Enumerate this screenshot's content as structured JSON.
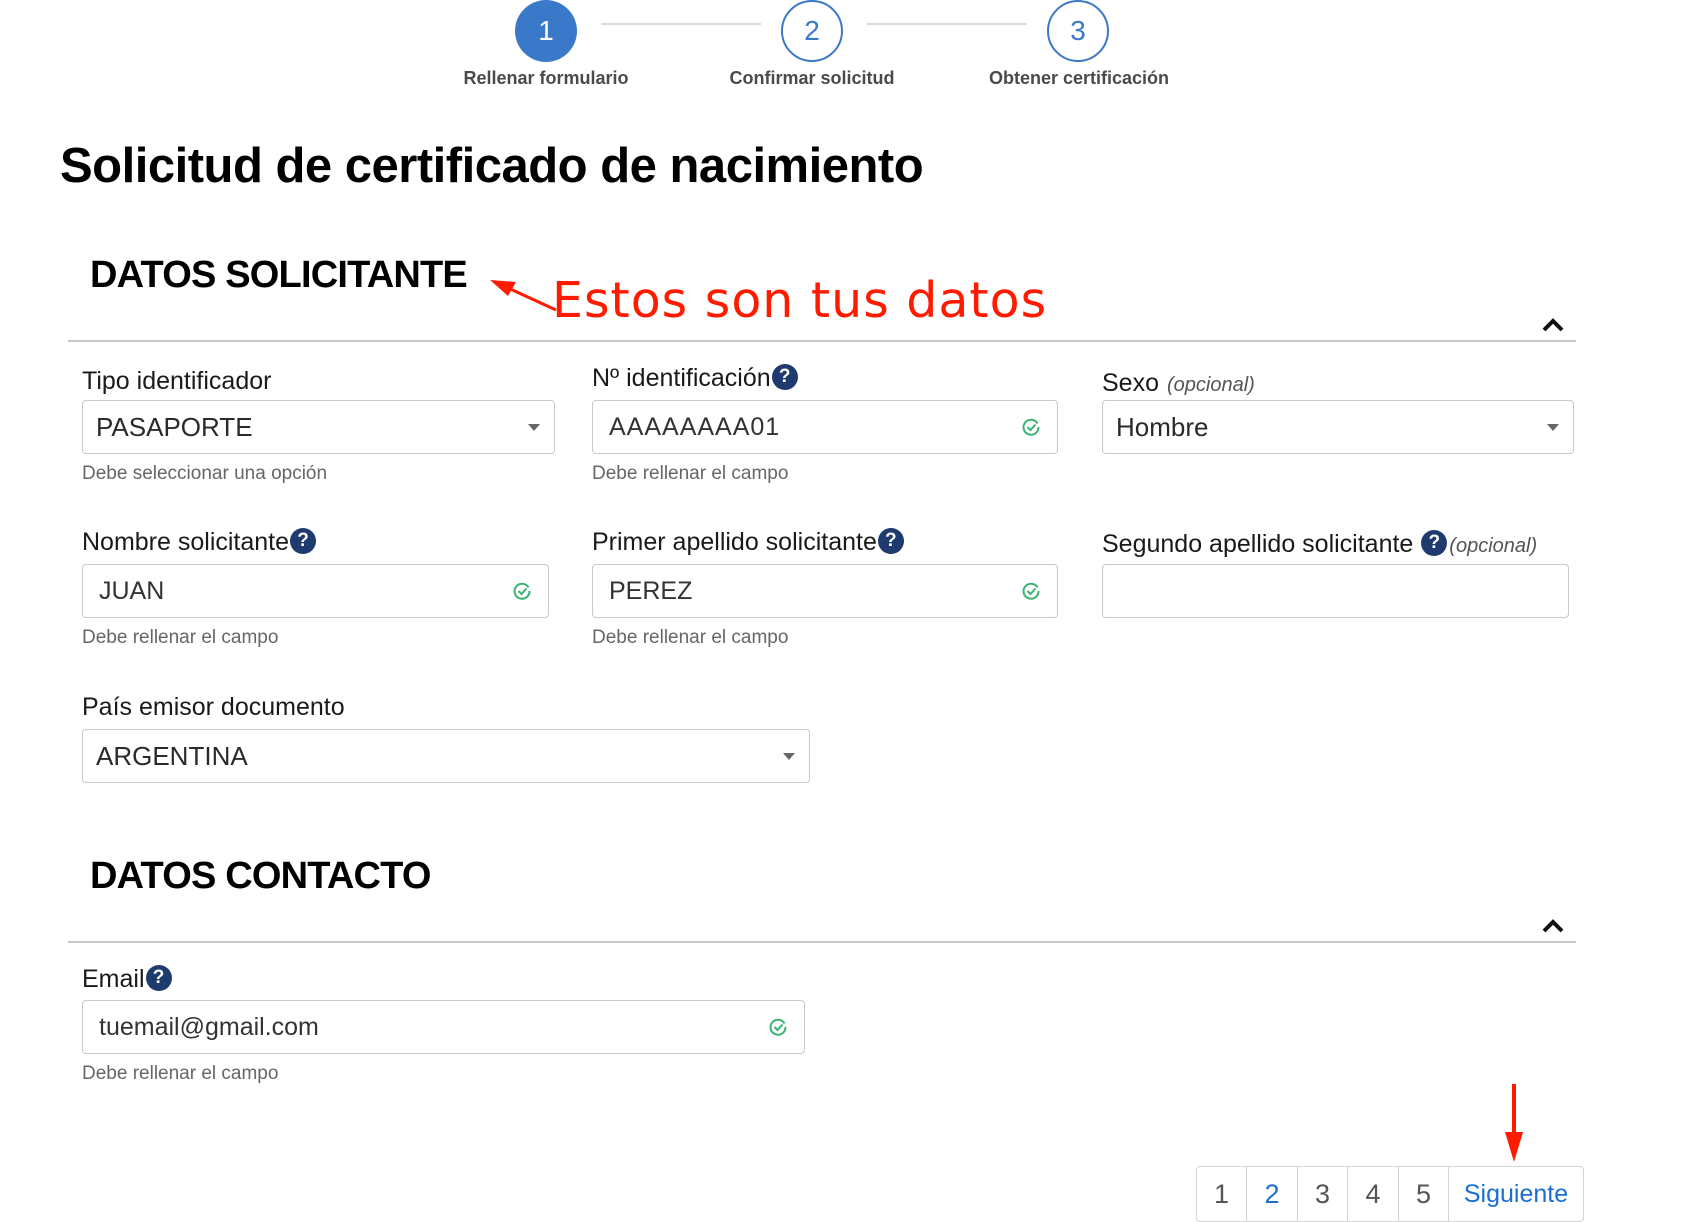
{
  "stepper": {
    "steps": [
      {
        "number": "1",
        "label": "Rellenar formulario",
        "state": "active"
      },
      {
        "number": "2",
        "label": "Confirmar solicitud",
        "state": "pending"
      },
      {
        "number": "3",
        "label": "Obtener certificación",
        "state": "pending"
      }
    ]
  },
  "page": {
    "title": "Solicitud de certificado de nacimiento"
  },
  "annotations": {
    "section_note": "Estos son tus datos",
    "color": "#ff1a00"
  },
  "sections": {
    "applicant": {
      "title": "DATOS SOLICITANTE",
      "fields": {
        "id_type": {
          "label": "Tipo identificador",
          "value": "PASAPORTE",
          "helper": "Debe seleccionar una opción"
        },
        "id_number": {
          "label": "Nº identificación",
          "value": "AAAAAAAA01",
          "helper": "Debe rellenar el campo"
        },
        "sex": {
          "label": "Sexo",
          "optional": "(opcional)",
          "value": "Hombre"
        },
        "first_name": {
          "label": "Nombre solicitante",
          "value": "JUAN",
          "helper": "Debe rellenar el campo"
        },
        "last_name_1": {
          "label": "Primer apellido solicitante",
          "value": "PEREZ",
          "helper": "Debe rellenar el campo"
        },
        "last_name_2": {
          "label": "Segundo apellido solicitante",
          "optional": "(opcional)",
          "value": ""
        },
        "issuing_country": {
          "label": "País emisor documento",
          "value": "ARGENTINA"
        }
      }
    },
    "contact": {
      "title": "DATOS CONTACTO",
      "fields": {
        "email": {
          "label": "Email",
          "value": "tuemail@gmail.com",
          "helper": "Debe rellenar el campo"
        }
      }
    }
  },
  "help_icon_glyph": "?",
  "pagination": {
    "pages": [
      "1",
      "2",
      "3",
      "4",
      "5"
    ],
    "next_label": "Siguiente"
  },
  "colors": {
    "primary": "#3a78c9",
    "valid_check": "#3cb371",
    "help_icon": "#1e3a6e",
    "link": "#1a6fd1"
  }
}
